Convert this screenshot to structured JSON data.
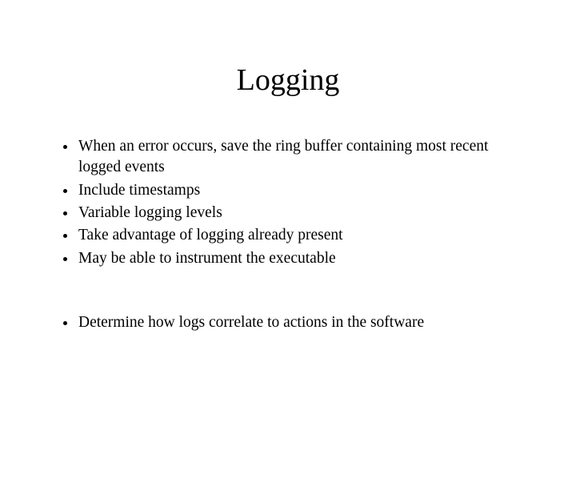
{
  "title": "Logging",
  "bullets_top": [
    "When an error occurs, save the ring buffer containing most recent logged events",
    "Include timestamps",
    "Variable logging levels",
    "Take advantage of logging already present",
    "May be able to instrument the executable"
  ],
  "bullets_bottom": [
    "Determine how logs correlate to actions in the software"
  ]
}
